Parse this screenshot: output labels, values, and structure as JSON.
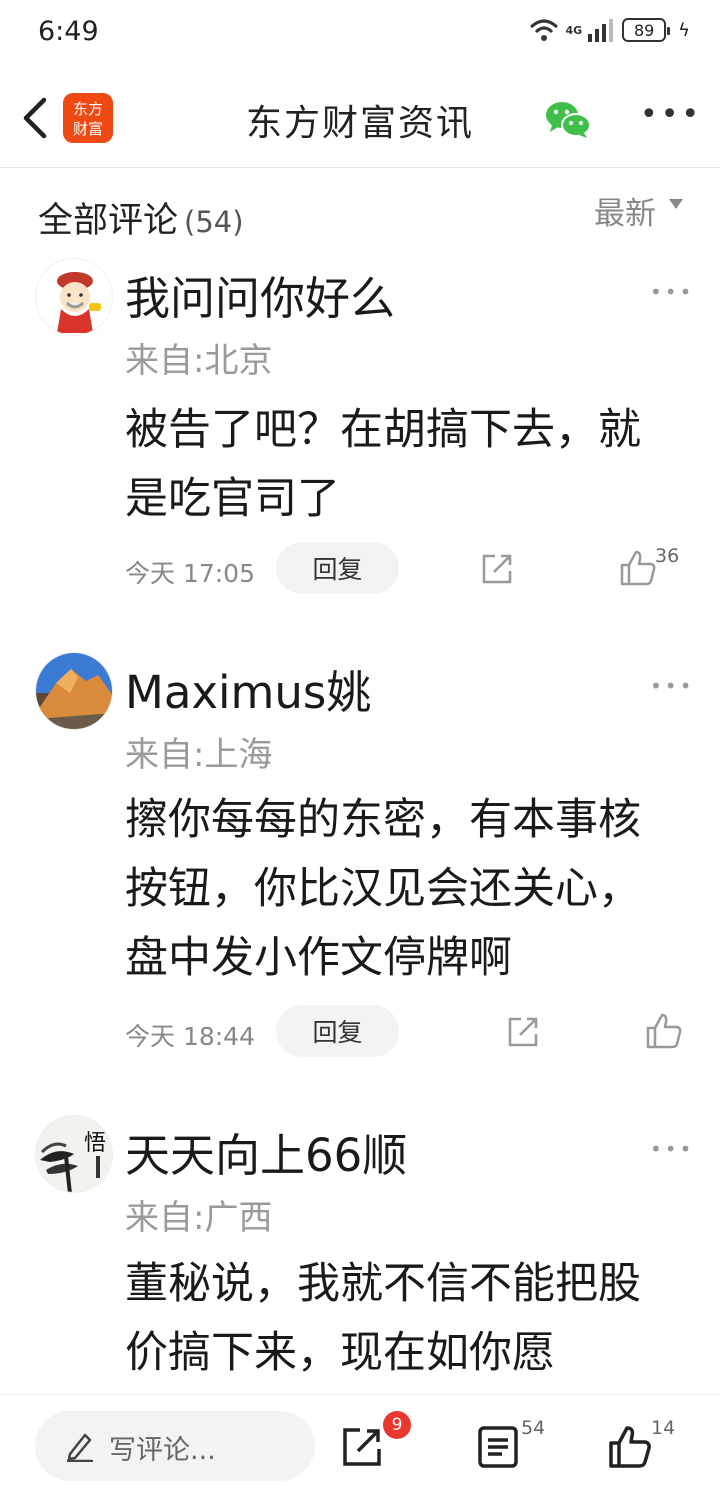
{
  "status_bar": {
    "time": "6:49",
    "network": "4G",
    "battery": "89"
  },
  "nav": {
    "logo_line1": "东方",
    "logo_line2": "财富",
    "title": "东方财富资讯"
  },
  "section": {
    "title": "全部评论",
    "count": "(54)",
    "sort": "最新"
  },
  "comments": [
    {
      "username": "我问问你好么",
      "location": "来自:北京",
      "text": "被告了吧？在胡搞下去，就是吃官司了",
      "time": "今天 17:05",
      "reply_label": "回复",
      "likes": "36"
    },
    {
      "username": "Maximus姚",
      "location": "来自:上海",
      "text": "擦你每每的东密，有本事核按钮，你比汉见会还关心，盘中发小作文停牌啊",
      "time": "今天 18:44",
      "reply_label": "回复",
      "likes": ""
    },
    {
      "username": "天天向上66顺",
      "location": "来自:广西",
      "text": "董秘说，我就不信不能把股价搞下来，现在如你愿"
    }
  ],
  "bottom_bar": {
    "write_placeholder": "写评论...",
    "share_badge": "9",
    "comment_count": "54",
    "like_count": "14"
  },
  "colors": {
    "brand": "#f04a14",
    "badge": "#e8372f",
    "wechat": "#3fbf4a"
  },
  "icons": [
    "back-arrow-icon",
    "wechat-icon",
    "more-icon",
    "share-icon",
    "like-icon",
    "pencil-icon",
    "comment-list-icon"
  ]
}
